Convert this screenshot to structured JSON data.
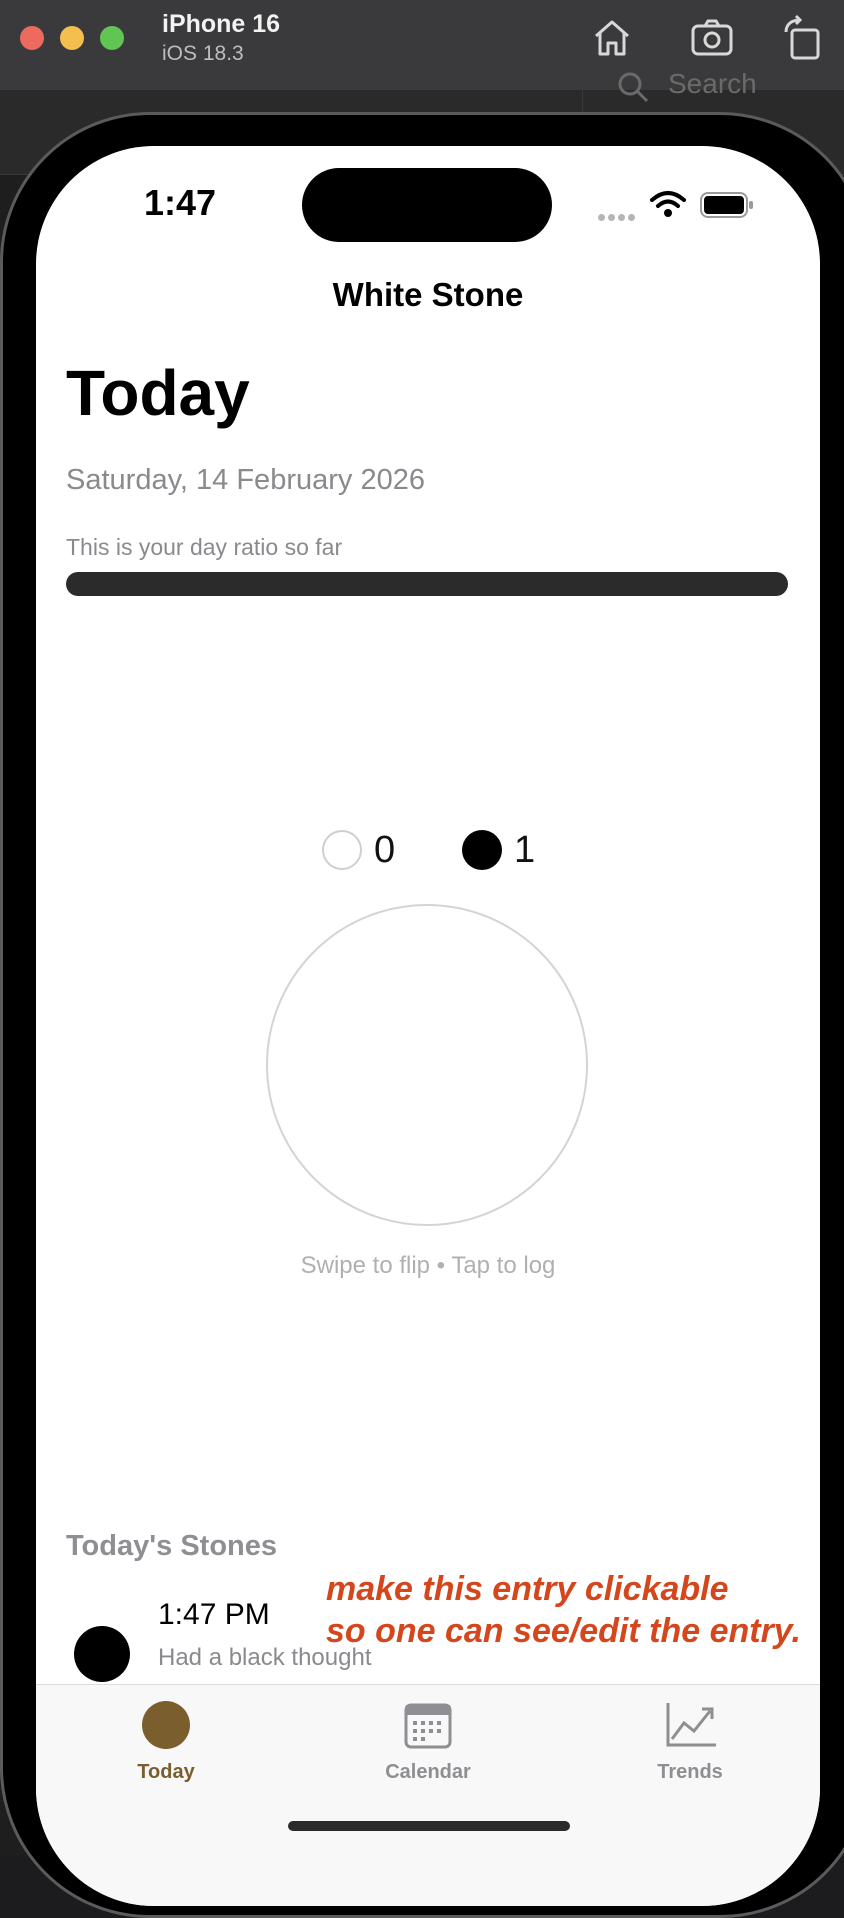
{
  "simulator": {
    "device_name": "iPhone 16",
    "os_version": "iOS 18.3",
    "toolbar_icons": [
      "home-icon",
      "screenshot-icon",
      "rotate-icon"
    ]
  },
  "background": {
    "search_placeholder": "Search"
  },
  "status_bar": {
    "time": "1:47"
  },
  "app": {
    "nav_title": "White Stone",
    "large_title": "Today",
    "date": "Saturday, 14 February 2026",
    "ratio_label": "This is your day ratio so far",
    "ratio_white_fraction": 0,
    "counts": {
      "white": "0",
      "black": "1"
    },
    "stone_hint": "Swipe to flip • Tap to log",
    "stones_section_title": "Today's Stones",
    "entries": [
      {
        "time": "1:47 PM",
        "note": "Had a black thought",
        "stone_color": "black"
      }
    ]
  },
  "annotation": {
    "line1": "make this entry clickable",
    "line2": "so one can see/edit the entry.",
    "color": "#d4471c"
  },
  "tabbar": {
    "tabs": [
      {
        "label": "Today",
        "icon": "stone-icon",
        "selected": true,
        "color": "#7a5e2e"
      },
      {
        "label": "Calendar",
        "icon": "calendar-icon",
        "selected": false
      },
      {
        "label": "Trends",
        "icon": "trend-chart-icon",
        "selected": false
      }
    ]
  }
}
